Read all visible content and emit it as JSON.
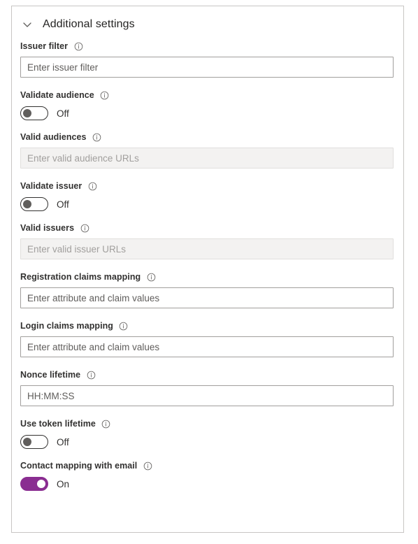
{
  "panel": {
    "header": {
      "title": "Additional settings",
      "chevron_icon": "chevron-down-icon"
    },
    "accent_color": "#8a2d91",
    "label_color": "#323130",
    "border_color": "#c8c6c4",
    "disabled_background": "#f3f2f1",
    "fields": [
      {
        "id": "issuer-filter",
        "label": "Issuer filter",
        "type": "text",
        "placeholder": "Enter issuer filter",
        "value": "",
        "disabled": false,
        "info_icon": "info-icon"
      },
      {
        "id": "validate-audience",
        "label": "Validate audience",
        "type": "toggle",
        "state": "Off",
        "on": false,
        "info_icon": "info-icon"
      },
      {
        "id": "valid-audiences",
        "label": "Valid audiences",
        "type": "text",
        "placeholder": "Enter valid audience URLs",
        "value": "",
        "disabled": true,
        "info_icon": "info-icon"
      },
      {
        "id": "validate-issuer",
        "label": "Validate issuer",
        "type": "toggle",
        "state": "Off",
        "on": false,
        "info_icon": "info-icon"
      },
      {
        "id": "valid-issuers",
        "label": "Valid issuers",
        "type": "text",
        "placeholder": "Enter valid issuer URLs",
        "value": "",
        "disabled": true,
        "info_icon": "info-icon"
      },
      {
        "id": "registration-claims-mapping",
        "label": "Registration claims mapping",
        "type": "text",
        "placeholder": "Enter attribute and claim values",
        "value": "",
        "disabled": false,
        "info_icon": "info-icon"
      },
      {
        "id": "login-claims-mapping",
        "label": "Login claims mapping",
        "type": "text",
        "placeholder": "Enter attribute and claim values",
        "value": "",
        "disabled": false,
        "info_icon": "info-icon"
      },
      {
        "id": "nonce-lifetime",
        "label": "Nonce lifetime",
        "type": "text",
        "placeholder": "HH:MM:SS",
        "value": "",
        "disabled": false,
        "info_icon": "info-icon"
      },
      {
        "id": "use-token-lifetime",
        "label": "Use token lifetime",
        "type": "toggle",
        "state": "Off",
        "on": false,
        "info_icon": "info-icon"
      },
      {
        "id": "contact-mapping-with-email",
        "label": "Contact mapping with email",
        "type": "toggle",
        "state": "On",
        "on": true,
        "info_icon": "info-icon"
      }
    ]
  }
}
